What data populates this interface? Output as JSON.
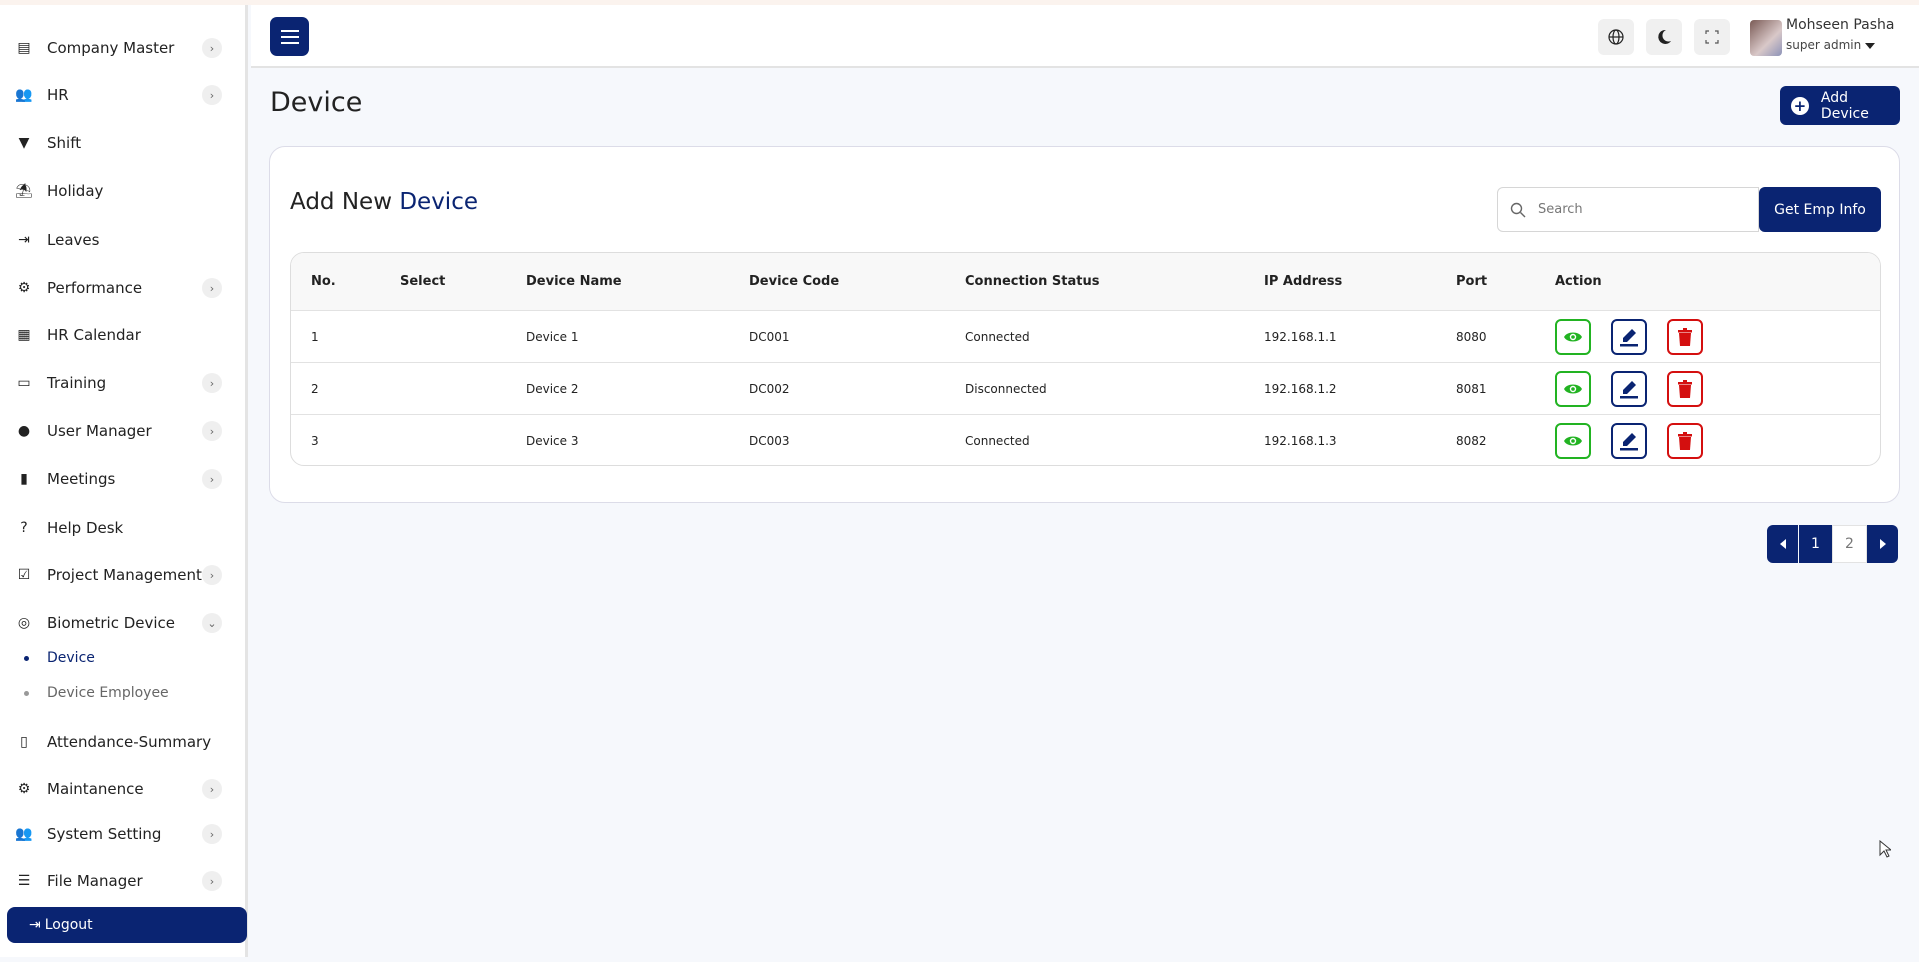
{
  "sidebar": {
    "items": [
      {
        "label": "Company Master",
        "icon": "server-icon",
        "chevron": true
      },
      {
        "label": "HR",
        "icon": "users-icon",
        "chevron": true
      },
      {
        "label": "Shift",
        "icon": "filter-icon",
        "chevron": false
      },
      {
        "label": "Holiday",
        "icon": "umbrella-beach-icon",
        "chevron": false
      },
      {
        "label": "Leaves",
        "icon": "sign-out-icon",
        "chevron": false
      },
      {
        "label": "Performance",
        "icon": "gears-icon",
        "chevron": true
      },
      {
        "label": "HR Calendar",
        "icon": "calendar-icon",
        "chevron": false
      },
      {
        "label": "Training",
        "icon": "chalkboard-teacher-icon",
        "chevron": true
      },
      {
        "label": "User Manager",
        "icon": "user-icon",
        "chevron": true
      },
      {
        "label": "Meetings",
        "icon": "door-icon",
        "chevron": true
      },
      {
        "label": "Help Desk",
        "icon": "question-circle-icon",
        "chevron": false
      },
      {
        "label": "Project Management",
        "icon": "check-square-icon",
        "chevron": true
      },
      {
        "label": "Biometric Device",
        "icon": "fingerprint-icon",
        "chevron": true
      },
      {
        "label": "Attendance-Summary",
        "icon": "id-badge-icon",
        "chevron": false
      },
      {
        "label": "Maintanence",
        "icon": "user-gear-icon",
        "chevron": true
      },
      {
        "label": "System Setting",
        "icon": "users-cog-icon",
        "chevron": true
      },
      {
        "label": "File Manager",
        "icon": "list-check-icon",
        "chevron": true
      }
    ],
    "subitems": [
      {
        "label": "Device",
        "active": true
      },
      {
        "label": "Device Employee",
        "active": false
      }
    ],
    "logout": "Logout"
  },
  "header": {
    "user_name": "Mohseen Pasha",
    "user_role": "super admin"
  },
  "page": {
    "title": "Device",
    "add_button": "Add Device"
  },
  "card": {
    "title_prefix": "Add New",
    "title_accent": "Device",
    "search_placeholder": "Search",
    "get_emp_button": "Get Emp Info"
  },
  "table": {
    "columns": [
      "No.",
      "Select",
      "Device Name",
      "Device Code",
      "Connection Status",
      "IP Address",
      "Port",
      "Action"
    ],
    "rows": [
      {
        "no": "1",
        "name": "Device 1",
        "code": "DC001",
        "status": "Connected",
        "ip": "192.168.1.1",
        "port": "8080"
      },
      {
        "no": "2",
        "name": "Device 2",
        "code": "DC002",
        "status": "Disconnected",
        "ip": "192.168.1.2",
        "port": "8081"
      },
      {
        "no": "3",
        "name": "Device 3",
        "code": "DC003",
        "status": "Connected",
        "ip": "192.168.1.3",
        "port": "8082"
      }
    ]
  },
  "pagination": {
    "pages": [
      "1",
      "2"
    ],
    "current": "1"
  },
  "colors": {
    "primary": "#0a2472",
    "view": "#22b322",
    "delete": "#d40f0f"
  }
}
